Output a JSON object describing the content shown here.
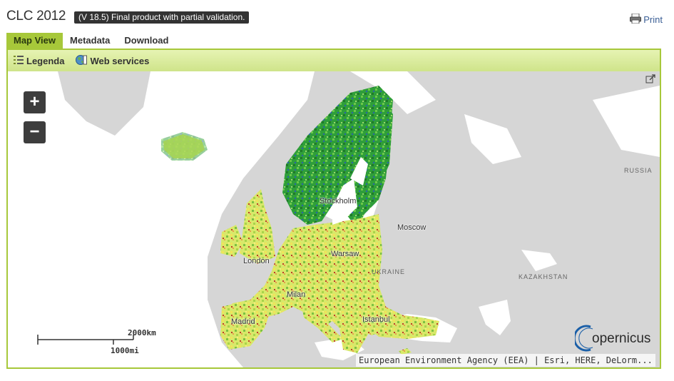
{
  "header": {
    "title": "CLC 2012",
    "version_badge": "(V 18.5) Final product with partial validation.",
    "print_label": "Print"
  },
  "tabs": [
    {
      "label": "Map View",
      "active": true
    },
    {
      "label": "Metadata",
      "active": false
    },
    {
      "label": "Download",
      "active": false
    }
  ],
  "toolbar": {
    "legend_label": "Legenda",
    "webservices_label": "Web services"
  },
  "map": {
    "zoom_in": "+",
    "zoom_out": "−",
    "labels": {
      "stockholm": "Stockholm",
      "moscow": "Moscow",
      "london": "London",
      "warsaw": "Warsaw",
      "ukraine": "UKRAINE",
      "russia": "RUSSIA",
      "kazakhstan": "KAZAKHSTAN",
      "milan": "Milan",
      "madrid": "Madrid",
      "istanbul": "Istanbul"
    },
    "scale_km": "2000km",
    "scale_mi": "1000mi",
    "logo_text": "opernicus",
    "attribution": "European Environment Agency (EEA) | Esri, HERE, DeLorm..."
  },
  "colors": {
    "accent": "#a7c83a",
    "map_background": "#d6d6d6",
    "water": "#ffffff"
  }
}
